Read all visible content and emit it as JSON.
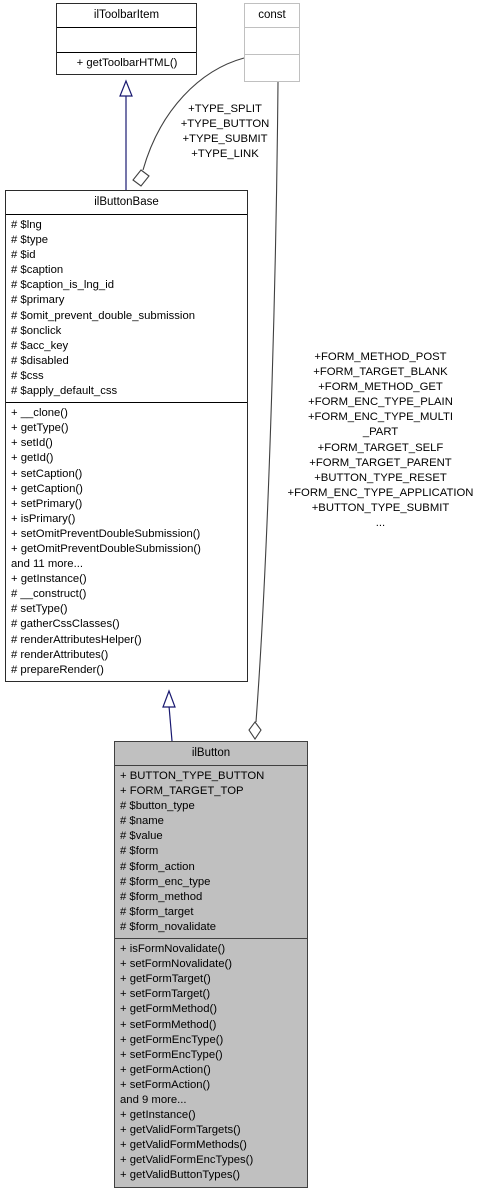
{
  "diagram": {
    "type": "uml-class-diagram",
    "title": "ilButton class hierarchy",
    "background_color": "#ffffff",
    "line_color": "#404040",
    "inheritance_color": "#191970",
    "filled_box_color": "#c0c0c0"
  },
  "classes": {
    "toolbar_item": {
      "name": "ilToolbarItem",
      "attributes": [],
      "methods": [
        "+ getToolbarHTML()"
      ]
    },
    "const": {
      "name": "const",
      "attributes": [],
      "methods": []
    },
    "button_base": {
      "name": "ilButtonBase",
      "attributes": [
        "# $lng",
        "# $type",
        "# $id",
        "# $caption",
        "# $caption_is_lng_id",
        "# $primary",
        "# $omit_prevent_double_submission",
        "# $onclick",
        "# $acc_key",
        "# $disabled",
        "# $css",
        "# $apply_default_css"
      ],
      "methods": [
        "+ __clone()",
        "+ getType()",
        "+ setId()",
        "+ getId()",
        "+ setCaption()",
        "+ getCaption()",
        "+ setPrimary()",
        "+ isPrimary()",
        "+ setOmitPreventDoubleSubmission()",
        "+ getOmitPreventDoubleSubmission()",
        "and 11 more...",
        "+ getInstance()",
        "# __construct()",
        "# setType()",
        "# gatherCssClasses()",
        "# renderAttributesHelper()",
        "# renderAttributes()",
        "# prepareRender()"
      ]
    },
    "button": {
      "name": "ilButton",
      "attributes": [
        "+ BUTTON_TYPE_BUTTON",
        "+ FORM_TARGET_TOP",
        "# $button_type",
        "# $name",
        "# $value",
        "# $form",
        "# $form_action",
        "# $form_enc_type",
        "# $form_method",
        "# $form_target",
        "# $form_novalidate"
      ],
      "methods": [
        "+ isFormNovalidate()",
        "+ setFormNovalidate()",
        "+ getFormTarget()",
        "+ setFormTarget()",
        "+ getFormMethod()",
        "+ setFormMethod()",
        "+ getFormEncType()",
        "+ setFormEncType()",
        "+ getFormAction()",
        "+ setFormAction()",
        "and 9 more...",
        "+ getInstance()",
        "+ getValidFormTargets()",
        "+ getValidFormMethods()",
        "+ getValidFormEncTypes()",
        "+ getValidButtonTypes()"
      ]
    }
  },
  "edges": {
    "const_to_button_base_label": "+TYPE_SPLIT\n+TYPE_BUTTON\n+TYPE_SUBMIT\n+TYPE_LINK",
    "const_to_button_label": "+FORM_METHOD_POST\n+FORM_TARGET_BLANK\n+FORM_METHOD_GET\n+FORM_ENC_TYPE_PLAIN\n+FORM_ENC_TYPE_MULTI\n_PART\n+FORM_TARGET_SELF\n+FORM_TARGET_PARENT\n+BUTTON_TYPE_RESET\n+FORM_ENC_TYPE_APPLICATION\n+BUTTON_TYPE_SUBMIT\n..."
  }
}
